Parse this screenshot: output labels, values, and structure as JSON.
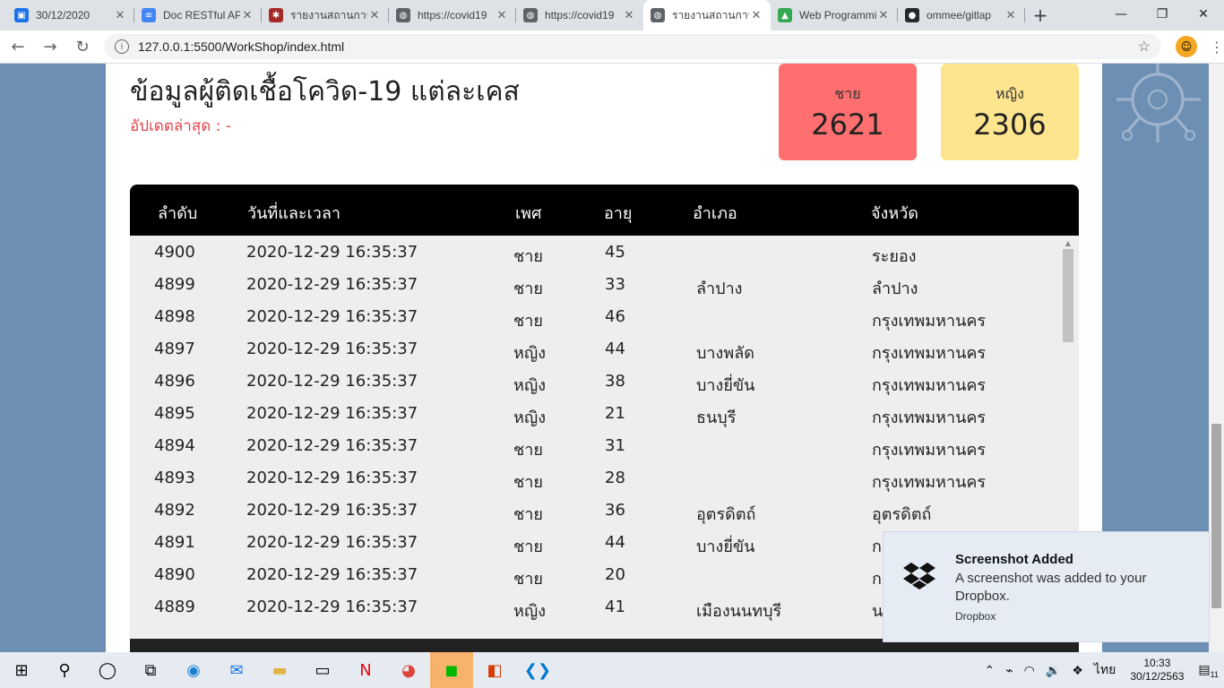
{
  "browser": {
    "tabs": [
      {
        "label": "30/12/2020",
        "fav_color": "#1a73e8",
        "fav": "▣"
      },
      {
        "label": "Doc RESTful API",
        "fav_color": "#4285f4",
        "fav": "≡"
      },
      {
        "label": "รายงานสถานการณ์",
        "fav_color": "#a52a2a",
        "fav": "✱"
      },
      {
        "label": "https://covid19",
        "fav_color": "#5f6368",
        "fav": "◍"
      },
      {
        "label": "https://covid19",
        "fav_color": "#5f6368",
        "fav": "◍"
      },
      {
        "label": "รายงานสถานการณ์",
        "fav_color": "#5f6368",
        "fav": "◍"
      },
      {
        "label": "Web Programming",
        "fav_color": "#34a853",
        "fav": "▲"
      },
      {
        "label": "ommee/gitlap",
        "fav_color": "#24292e",
        "fav": "●"
      }
    ],
    "active_tab_index": 5,
    "url": "127.0.0.1:5500/WorkShop/index.html"
  },
  "page": {
    "title": "ข้อมูลผู้ติดเชื้อโควิด-19 แต่ละเคส",
    "updated_label": "อัปเดตล่าสุด : -",
    "stats": {
      "male_label": "ชาย",
      "male_value": "2621",
      "female_label": "หญิง",
      "female_value": "2306"
    },
    "table": {
      "headers": [
        "ลำดับ",
        "วันที่และเวลา",
        "เพศ",
        "อายุ",
        "อำเภอ",
        "จังหวัด"
      ],
      "rows": [
        [
          "4900",
          "2020-12-29 16:35:37",
          "ชาย",
          "45",
          "",
          "ระยอง"
        ],
        [
          "4899",
          "2020-12-29 16:35:37",
          "ชาย",
          "33",
          "ลำปาง",
          "ลำปาง"
        ],
        [
          "4898",
          "2020-12-29 16:35:37",
          "ชาย",
          "46",
          "",
          "กรุงเทพมหานคร"
        ],
        [
          "4897",
          "2020-12-29 16:35:37",
          "หญิง",
          "44",
          "บางพลัด",
          "กรุงเทพมหานคร"
        ],
        [
          "4896",
          "2020-12-29 16:35:37",
          "หญิง",
          "38",
          "บางยี่ขัน",
          "กรุงเทพมหานคร"
        ],
        [
          "4895",
          "2020-12-29 16:35:37",
          "หญิง",
          "21",
          "ธนบุรี",
          "กรุงเทพมหานคร"
        ],
        [
          "4894",
          "2020-12-29 16:35:37",
          "ชาย",
          "31",
          "",
          "กรุงเทพมหานคร"
        ],
        [
          "4893",
          "2020-12-29 16:35:37",
          "ชาย",
          "28",
          "",
          "กรุงเทพมหานคร"
        ],
        [
          "4892",
          "2020-12-29 16:35:37",
          "ชาย",
          "36",
          "อุตรดิตถ์",
          "อุตรดิตถ์"
        ],
        [
          "4891",
          "2020-12-29 16:35:37",
          "ชาย",
          "44",
          "บางยี่ขัน",
          "กรุงเทพมหานคร"
        ],
        [
          "4890",
          "2020-12-29 16:35:37",
          "ชาย",
          "20",
          "",
          "กรุงเทพมหานคร"
        ],
        [
          "4889",
          "2020-12-29 16:35:37",
          "หญิง",
          "41",
          "เมืองนนทบุรี",
          "นนทบุรี"
        ]
      ]
    }
  },
  "toast": {
    "title": "Screenshot Added",
    "body": "A screenshot was added to your Dropbox.",
    "source": "Dropbox"
  },
  "taskbar": {
    "time": "10:33",
    "date": "30/12/2563",
    "language": "ไทย",
    "notification_count": "11"
  },
  "colors": {
    "male_card": "#ff6f6f",
    "female_card": "#fde48e",
    "updated_text": "#e0444a",
    "table_header": "#000000"
  }
}
